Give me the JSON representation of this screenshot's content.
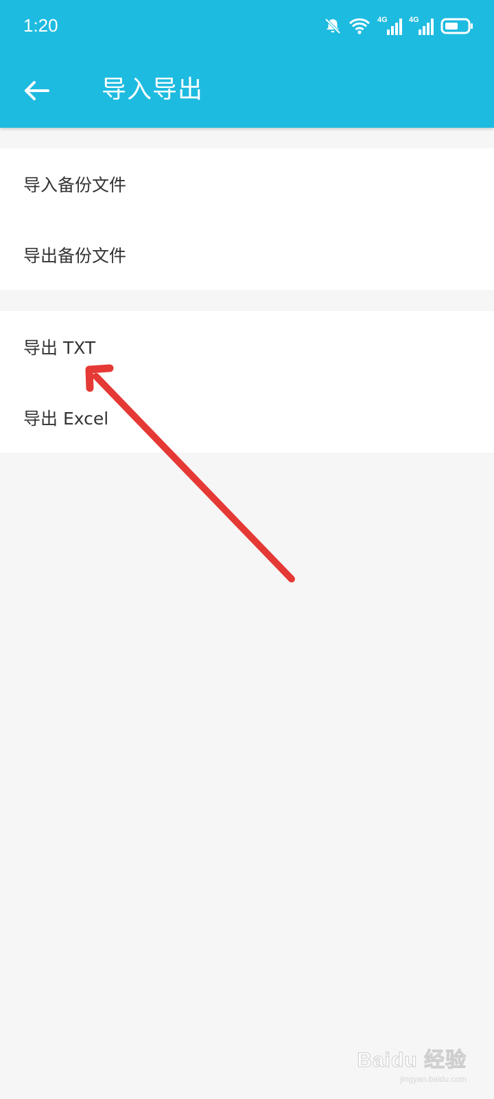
{
  "status_bar": {
    "time": "1:20",
    "icons": [
      "bell-muted-icon",
      "wifi-icon",
      "signal-4g-icon",
      "signal-4g-icon",
      "battery-icon"
    ],
    "signal_label_1": "4G",
    "signal_label_2": "4G"
  },
  "toolbar": {
    "back_icon": "arrow-left-icon",
    "title": "导入导出",
    "background_color": "#1ebbe0"
  },
  "menu": {
    "groups": [
      {
        "items": [
          {
            "label": "导入备份文件"
          },
          {
            "label": "导出备份文件"
          }
        ]
      },
      {
        "items": [
          {
            "label": "导出 TXT"
          },
          {
            "label": "导出 Excel"
          }
        ]
      }
    ]
  },
  "annotation": {
    "type": "red-arrow",
    "color": "#e53935",
    "points_to": "导出 TXT"
  },
  "watermark": {
    "logo": "Baidu 经验",
    "url": "jingyan.baidu.com"
  }
}
